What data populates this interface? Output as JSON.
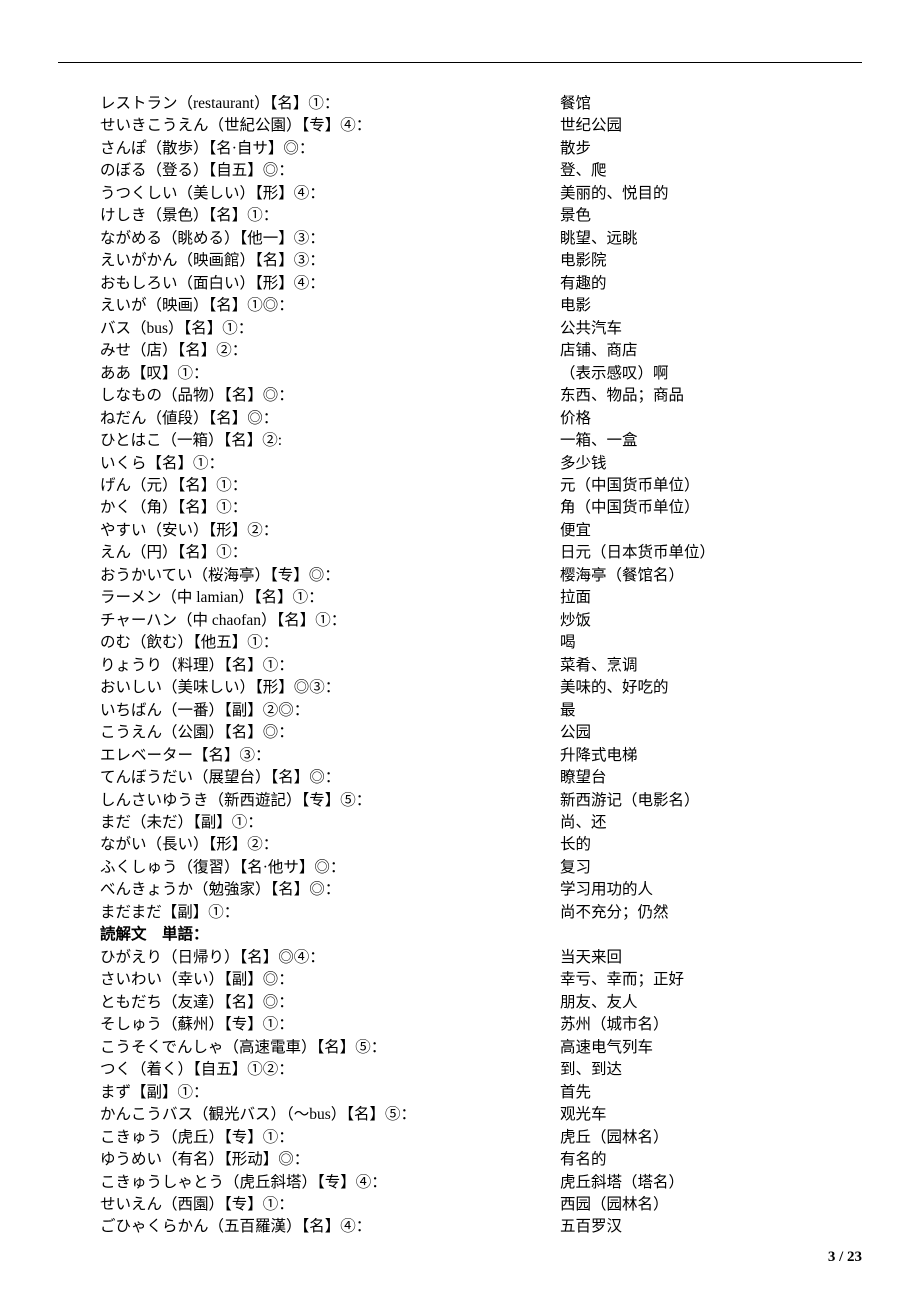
{
  "heading": "読解文　単語：",
  "page_footer": "3 / 23",
  "entries1": [
    {
      "jp": "レストラン（restaurant）【名】①：",
      "cn": "餐馆"
    },
    {
      "jp": "せいきこうえん（世紀公園）【专】④：",
      "cn": "世纪公园"
    },
    {
      "jp": "さんぽ（散歩）【名·自サ】◎：",
      "cn": "散步"
    },
    {
      "jp": "のぼる（登る）【自五】◎：",
      "cn": "登、爬"
    },
    {
      "jp": "うつくしい（美しい）【形】④：",
      "cn": "美丽的、悦目的"
    },
    {
      "jp": "けしき（景色）【名】①：",
      "cn": "景色"
    },
    {
      "jp": "ながめる（眺める）【他一】③：",
      "cn": "眺望、远眺"
    },
    {
      "jp": "えいがかん（映画館）【名】③：",
      "cn": "电影院"
    },
    {
      "jp": "おもしろい（面白い）【形】④：",
      "cn": "有趣的"
    },
    {
      "jp": "えいが（映画）【名】①◎：",
      "cn": "电影"
    },
    {
      "jp": "バス（bus）【名】①：",
      "cn": "公共汽车"
    },
    {
      "jp": "みせ（店）【名】②：",
      "cn": "店铺、商店"
    },
    {
      "jp": "ああ【叹】①：",
      "cn": "（表示感叹）啊"
    },
    {
      "jp": "しなもの（品物）【名】◎：",
      "cn": "东西、物品；商品"
    },
    {
      "jp": "ねだん（値段）【名】◎：",
      "cn": "价格"
    },
    {
      "jp": "ひとはこ（一箱）【名】②:",
      "cn": "一箱、一盒"
    },
    {
      "jp": "いくら【名】①：",
      "cn": "多少钱"
    },
    {
      "jp": "げん（元）【名】①：",
      "cn": "元（中国货币单位）"
    },
    {
      "jp": "かく（角）【名】①：",
      "cn": "角（中国货币单位）"
    },
    {
      "jp": "やすい（安い）【形】②：",
      "cn": "便宜"
    },
    {
      "jp": "えん（円）【名】①：",
      "cn": "日元（日本货币单位）"
    },
    {
      "jp": "おうかいてい（桜海亭）【专】◎：",
      "cn": "樱海亭（餐馆名）"
    },
    {
      "jp": "ラーメン（中 lamian）【名】①：",
      "cn": "拉面"
    },
    {
      "jp": "チャーハン（中 chaofan）【名】①：",
      "cn": "炒饭"
    },
    {
      "jp": "のむ（飲む）【他五】①：",
      "cn": "喝"
    },
    {
      "jp": "りょうり（料理）【名】①：",
      "cn": "菜肴、烹调"
    },
    {
      "jp": "おいしい（美味しい）【形】◎③：",
      "cn": "美味的、好吃的"
    },
    {
      "jp": "いちばん（一番）【副】②◎：",
      "cn": "最"
    },
    {
      "jp": "こうえん（公園）【名】◎：",
      "cn": "公园"
    },
    {
      "jp": "エレベーター【名】③：",
      "cn": "升降式电梯"
    },
    {
      "jp": "てんぼうだい（展望台）【名】◎：",
      "cn": "瞭望台"
    },
    {
      "jp": "しんさいゆうき（新西遊記）【专】⑤：",
      "cn": "新西游记（电影名）"
    },
    {
      "jp": "まだ（未だ）【副】①：",
      "cn": "尚、还"
    },
    {
      "jp": "ながい（長い）【形】②：",
      "cn": "长的"
    },
    {
      "jp": "ふくしゅう（復習）【名·他サ】◎：",
      "cn": "复习"
    },
    {
      "jp": "べんきょうか（勉強家）【名】◎：",
      "cn": "学习用功的人"
    },
    {
      "jp": "まだまだ【副】①：",
      "cn": "尚不充分；仍然"
    }
  ],
  "entries2": [
    {
      "jp": "ひがえり（日帰り）【名】◎④：",
      "cn": "当天来回"
    },
    {
      "jp": "さいわい（幸い）【副】◎：",
      "cn": "幸亏、幸而；正好"
    },
    {
      "jp": "ともだち（友達）【名】◎：",
      "cn": "朋友、友人"
    },
    {
      "jp": "そしゅう（蘇州）【专】①：",
      "cn": "苏州（城市名）"
    },
    {
      "jp": "こうそくでんしゃ（高速電車）【名】⑤：",
      "cn": "高速电气列车"
    },
    {
      "jp": "つく（着く）【自五】①②：",
      "cn": "到、到达"
    },
    {
      "jp": "まず【副】①：",
      "cn": "首先"
    },
    {
      "jp": "かんこうバス（観光バス）（～bus）【名】⑤：",
      "cn": "观光车"
    },
    {
      "jp": "こきゅう（虎丘）【专】①：",
      "cn": "虎丘（园林名）"
    },
    {
      "jp": "ゆうめい（有名）【形动】◎：",
      "cn": "有名的"
    },
    {
      "jp": "こきゅうしゃとう（虎丘斜塔）【专】④：",
      "cn": "虎丘斜塔（塔名）"
    },
    {
      "jp": "せいえん（西園）【专】①：",
      "cn": "西园（园林名）"
    },
    {
      "jp": "ごひゃくらかん（五百羅漢）【名】④：",
      "cn": "五百罗汉"
    }
  ]
}
